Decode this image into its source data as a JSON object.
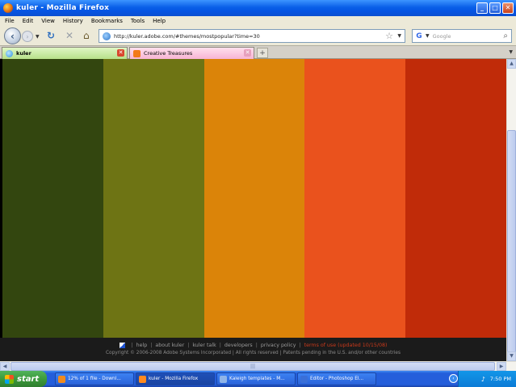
{
  "window": {
    "title": "kuler - Mozilla Firefox"
  },
  "menu": [
    "File",
    "Edit",
    "View",
    "History",
    "Bookmarks",
    "Tools",
    "Help"
  ],
  "nav": {
    "url": "http://kuler.adobe.com/#themes/mostpopular?time=30",
    "search_placeholder": "Google"
  },
  "tabs": [
    {
      "label": "kuler",
      "active": true
    },
    {
      "label": "Creative Treasures",
      "active": false
    }
  ],
  "swatches": [
    "#33460f",
    "#6e7414",
    "#db8409",
    "#ea521d",
    "#c02b09"
  ],
  "footer": {
    "links": [
      "help",
      "about kuler",
      "kuler talk",
      "developers",
      "privacy policy"
    ],
    "terms": "terms of use (updated 10/15/08)",
    "copyright": "Copyright © 2006-2008 Adobe Systems Incorporated | All rights reserved | Patents pending in the U.S. and/or other countries"
  },
  "taskbar": {
    "start": "start",
    "tasks": [
      {
        "label": "12% of 1 file - Downl...",
        "icon_color": "#f08b1f"
      },
      {
        "label": "kuler - Mozilla Firefox",
        "icon_color": "#ff8a1f"
      },
      {
        "label": "Kaleigh templates - M...",
        "icon_color": "#8fb4e8"
      },
      {
        "label": "Editor - Photoshop El...",
        "icon_color": "#3a6fd8"
      }
    ],
    "clock": "7:50 PM"
  }
}
